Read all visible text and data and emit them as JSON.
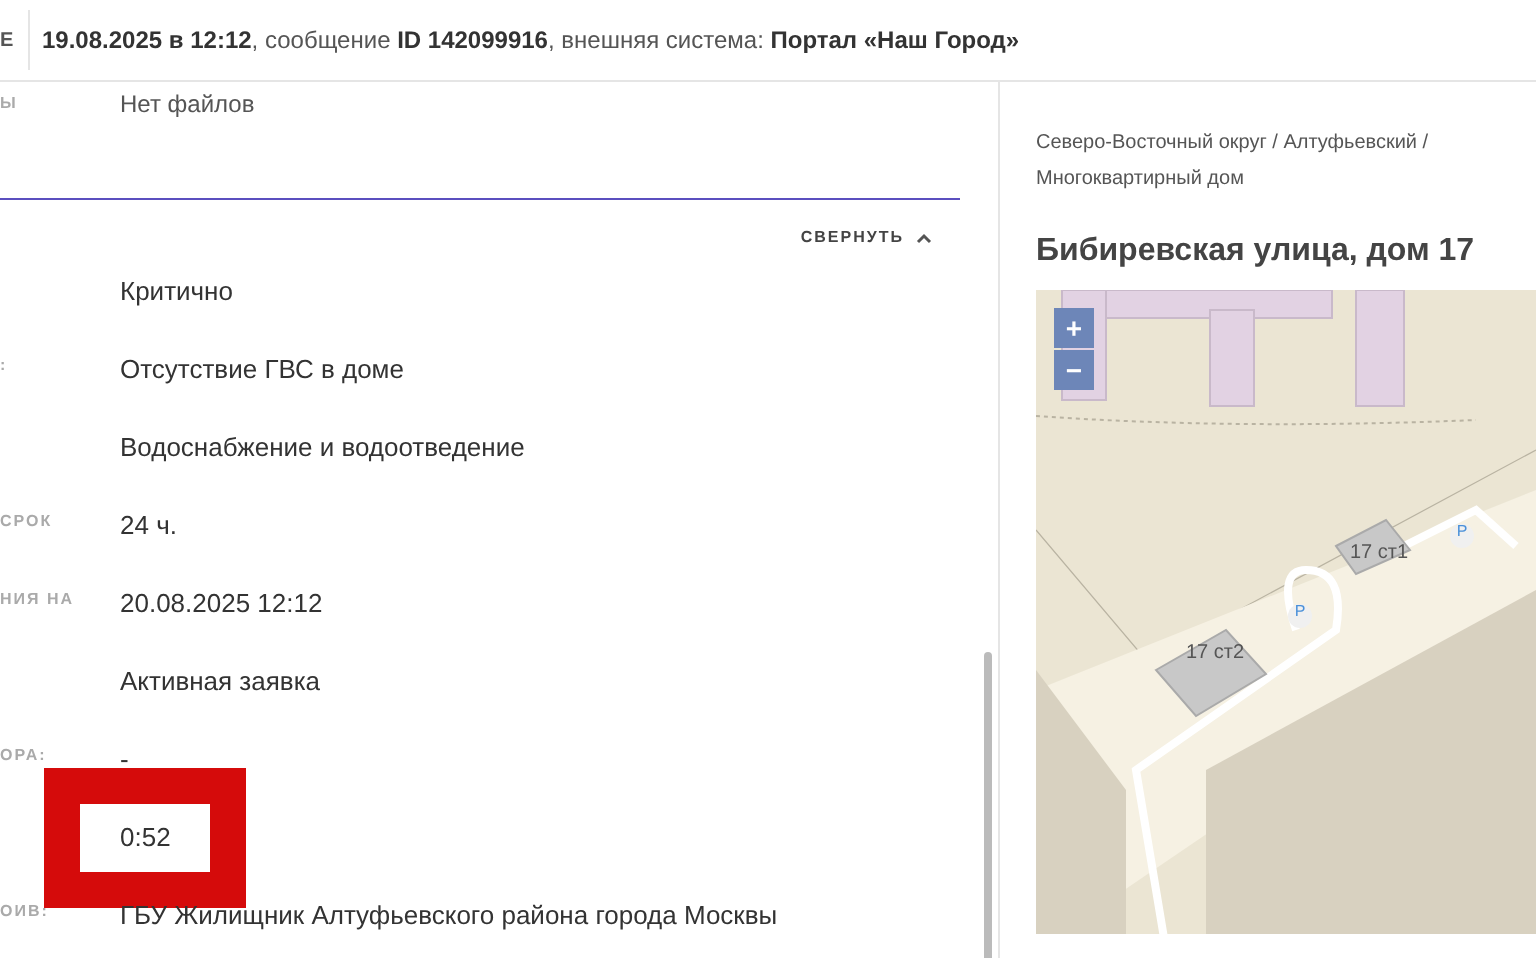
{
  "header": {
    "cut_label": "Е",
    "message": "**19.08.2025 в 12:12**, сообщение **ID 142099916**, внешняя система: **Портал «Наш Город»**"
  },
  "files_row": {
    "label": "Ы",
    "value": "Нет файлов"
  },
  "collapse_button": "СВЕРНУТЬ",
  "rows": [
    {
      "value": "Критично"
    },
    {
      "label": ":",
      "value": "Отсутствие ГВС в доме"
    },
    {
      "value": "Водоснабжение и водоотведение"
    },
    {
      "label": "СРОК",
      "value": "24 ч."
    },
    {
      "label": "НИЯ НА",
      "value": "20.08.2025 12:12"
    },
    {
      "value": "Активная заявка"
    },
    {
      "label": "ОРА:",
      "value": "-"
    },
    {
      "value": "0:52",
      "highlighted": true
    },
    {
      "label": "ОИВ:",
      "value": "ГБУ Жилищник Алтуфьевского района города Москвы"
    }
  ],
  "location": {
    "breadcrumb": "Северо-Восточный округ / Алтуфьевский / Многоквартирный дом",
    "address": "Бибиревская улица, дом 17"
  },
  "map": {
    "zoom_in": "+",
    "zoom_out": "−",
    "labels": [
      "17 ст1",
      "17 ст2"
    ],
    "parking": [
      "P",
      "P"
    ]
  }
}
